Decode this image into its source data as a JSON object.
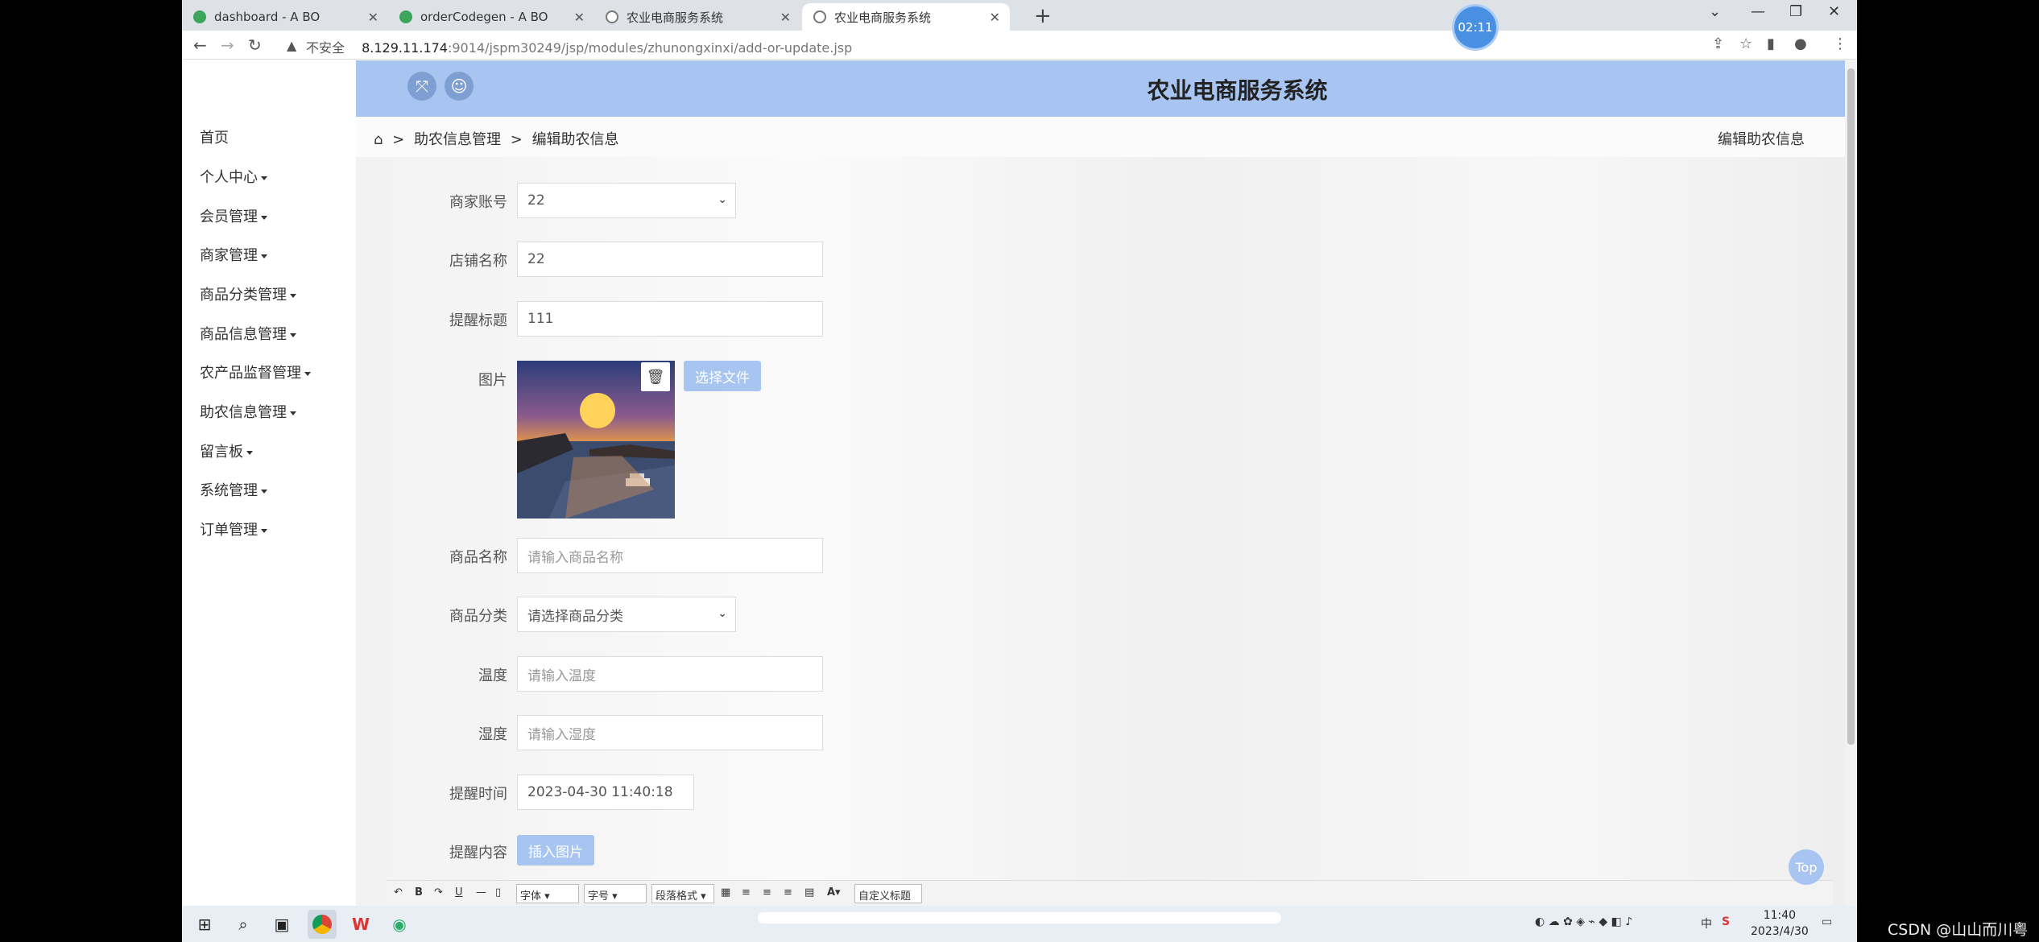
{
  "browser": {
    "tabs": [
      {
        "title": "dashboard - A BO",
        "favicon_color": "#3ba55c"
      },
      {
        "title": "orderCodegen - A BO",
        "favicon_color": "#3ba55c"
      },
      {
        "title": "农业电商服务系统",
        "favicon_color": "#777777"
      },
      {
        "title": "农业电商服务系统",
        "favicon_color": "#777777"
      }
    ],
    "address": {
      "security_label": "不安全",
      "host": "8.129.11.174",
      "path": ":9014/jspm30249/jsp/modules/zhunongxinxi/add-or-update.jsp"
    },
    "timer_badge": "02:11"
  },
  "app": {
    "title": "农业电商服务系统",
    "accent_color": "#a7c5f0",
    "sidebar": [
      {
        "label": "首页",
        "has_caret": false
      },
      {
        "label": "个人中心",
        "has_caret": true
      },
      {
        "label": "会员管理",
        "has_caret": true
      },
      {
        "label": "商家管理",
        "has_caret": true
      },
      {
        "label": "商品分类管理",
        "has_caret": true
      },
      {
        "label": "商品信息管理",
        "has_caret": true
      },
      {
        "label": "农产品监督管理",
        "has_caret": true
      },
      {
        "label": "助农信息管理",
        "has_caret": true
      },
      {
        "label": "留言板",
        "has_caret": true
      },
      {
        "label": "系统管理",
        "has_caret": true
      },
      {
        "label": "订单管理",
        "has_caret": true
      }
    ],
    "breadcrumb": {
      "sep": ">",
      "section": "助农信息管理",
      "current": "编辑助农信息",
      "right_title": "编辑助农信息"
    },
    "form": {
      "merchant_account": {
        "label": "商家账号",
        "value": "22"
      },
      "shop_name": {
        "label": "店铺名称",
        "value": "22"
      },
      "reminder_title": {
        "label": "提醒标题",
        "value": "111"
      },
      "image": {
        "label": "图片",
        "choose_file": "选择文件"
      },
      "product_name": {
        "label": "商品名称",
        "placeholder": "请输入商品名称"
      },
      "product_category": {
        "label": "商品分类",
        "placeholder": "请选择商品分类"
      },
      "temperature": {
        "label": "温度",
        "placeholder": "请输入温度"
      },
      "humidity": {
        "label": "湿度",
        "placeholder": "请输入湿度"
      },
      "reminder_time": {
        "label": "提醒时间",
        "value": "2023-04-30 11:40:18"
      },
      "reminder_content": {
        "label": "提醒内容",
        "insert_image": "插入图片"
      }
    },
    "editor_toolbar": {
      "font": "字体",
      "size": "字号",
      "paragraph": "段落格式",
      "custom_title": "自定义标题"
    },
    "top_button": "Top"
  },
  "taskbar": {
    "time": "11:40",
    "date": "2023/4/30",
    "ime": "中",
    "watermark": "CSDN @山山而川粤"
  }
}
